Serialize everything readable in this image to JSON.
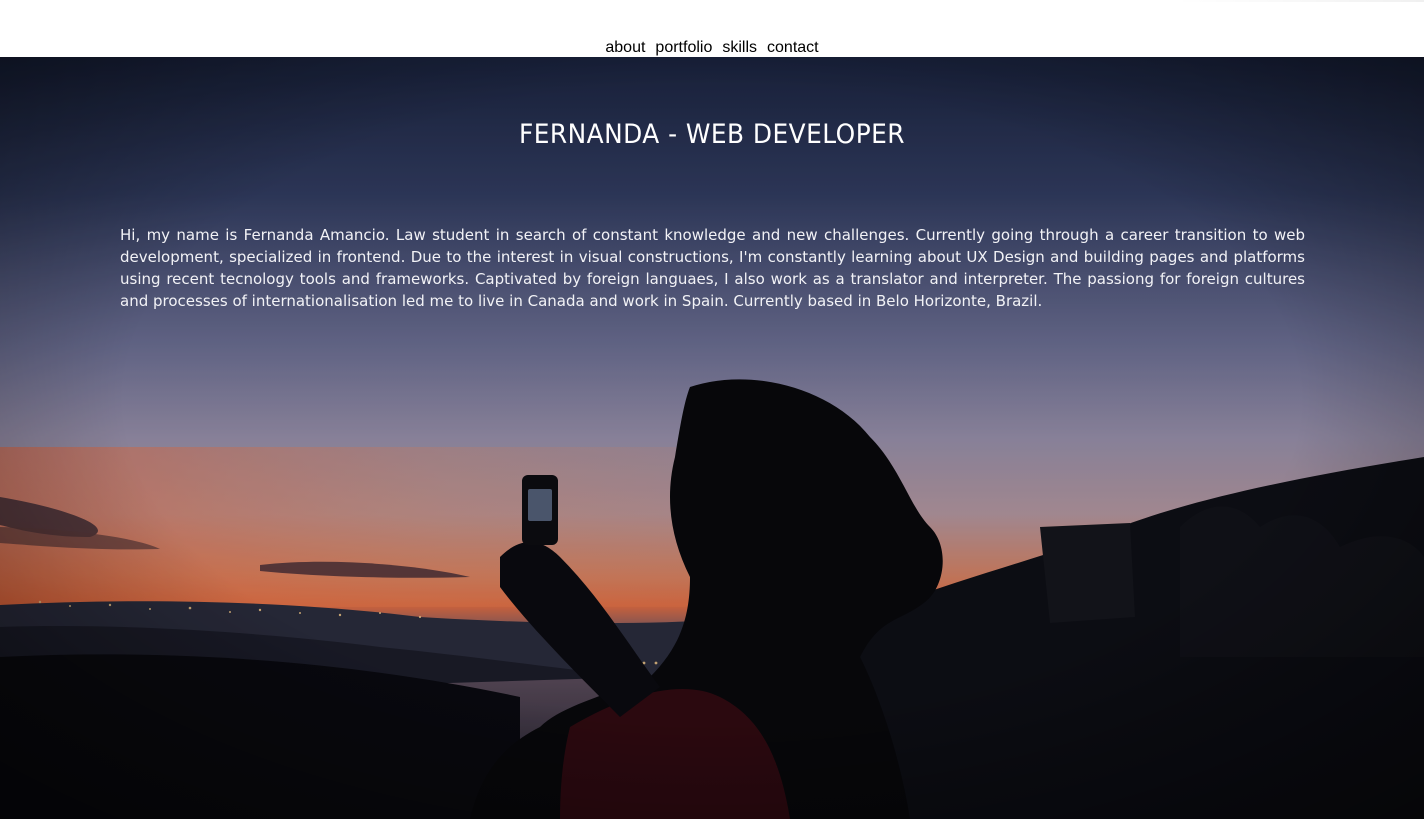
{
  "nav": {
    "items": [
      {
        "label": "about"
      },
      {
        "label": "portfolio"
      },
      {
        "label": "skills"
      },
      {
        "label": "contact"
      }
    ]
  },
  "hero": {
    "title": "FERNANDA - WEB DEVELOPER",
    "bio": "Hi, my name is Fernanda Amancio. Law student in search of constant knowledge and new challenges. Currently going through a career transition to web development, specialized in frontend. Due to the interest in visual constructions, I'm constantly learning about UX Design and building pages and platforms using recent tecnology tools and frameworks. Captivated by foreign languaes, I also work as a translator and interpreter. The passiong for foreign cultures and processes of internationalisation led me to live in Canada and work in Spain. Currently based in Belo Horizonte, Brazil.",
    "background": "sunset photo of woman taking a picture with a phone on a hill"
  },
  "colors": {
    "sky_top": "#1d2540",
    "sky_mid": "#7e7f9e",
    "horizon_glow": "#e5764a",
    "foreground": "#07070b",
    "nav_text": "#000000",
    "hero_text": "#ffffff"
  }
}
